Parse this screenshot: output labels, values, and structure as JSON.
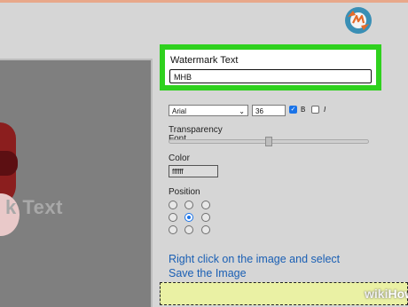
{
  "watermark": {
    "label": "Watermark Text",
    "value": "MHB"
  },
  "font": {
    "label": "Font",
    "family_value": "Arial",
    "size_value": "36",
    "bold_label": "B",
    "italic_label": "I",
    "bold_checked": true,
    "italic_checked": false
  },
  "transparency": {
    "label": "Transparency",
    "level": 0.5
  },
  "color": {
    "label": "Color",
    "value": "ffffff"
  },
  "position": {
    "label": "Position",
    "selected": "center"
  },
  "instruction": {
    "line1": "Right click on the image and select",
    "line2": "Save the Image"
  },
  "preview": {
    "watermark_text": "k Text"
  },
  "branding": {
    "wiki": "wiki",
    "how": "How"
  },
  "colors": {
    "highlight": "#2fd11e",
    "accent": "#1a73e8",
    "link": "#1a5fb4"
  }
}
